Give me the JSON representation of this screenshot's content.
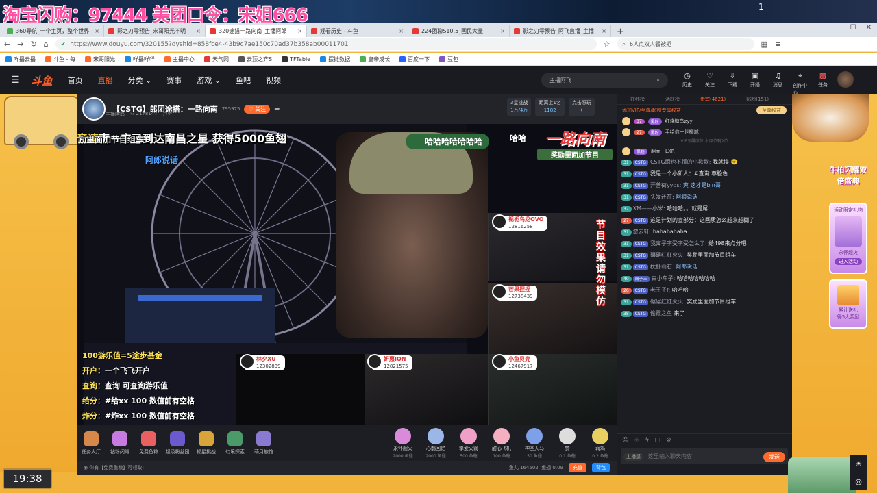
{
  "promo_banner": "淘宝闪购：97444 美团口令：宋姐666",
  "top_badge": "1",
  "tabs": [
    {
      "label": "360导航_一个主页，整个世界",
      "color": "#4caf50"
    },
    {
      "label": "影之刃零预告_宋哥阳光不明",
      "color": "#e53935"
    },
    {
      "label": "320途搭一路向南_主播阿郎",
      "color": "#e53935",
      "active": true
    },
    {
      "label": "观看历史 - 斗鱼",
      "color": "#e53935"
    },
    {
      "label": "224团聊S10.5_国民大量",
      "color": "#e53935"
    },
    {
      "label": "影之刃零预告_阿飞直播_主播",
      "color": "#e53935"
    }
  ],
  "new_tab": "+",
  "url": "https://www.douyu.com/320155?dyshid=858fce4-43b9c7ae150c70ad37b358ab00011701",
  "search_placeholder": "6人点双人餐被拒",
  "bookmarks": [
    "咩播云播",
    "斗鱼 - 每",
    "宋哥阳光",
    "咩播咩咩",
    "主播中心",
    "天气网",
    "云顶之弈S",
    "TFTable",
    "摆摊数据",
    "皇帝成长",
    "百度一下",
    "豆包"
  ],
  "dy": {
    "logo": "斗鱼",
    "nav": [
      "首页",
      "直播",
      "分类",
      "赛事",
      "游戏",
      "鱼吧",
      "视频"
    ],
    "active_nav": "直播",
    "search": "主播阿飞",
    "icons": [
      {
        "label": "历史",
        "icon": "clock-icon"
      },
      {
        "label": "关注",
        "icon": "heart-icon"
      },
      {
        "label": "下载",
        "icon": "download-icon"
      },
      {
        "label": "开播",
        "icon": "broadcast-icon"
      },
      {
        "label": "消息",
        "icon": "bell-icon"
      },
      {
        "label": "创作中心",
        "icon": "location-icon"
      },
      {
        "label": "任务",
        "icon": "gift-icon"
      }
    ]
  },
  "room": {
    "title": "【CSTG】郎团途搭：一路向南",
    "room_no": "795975",
    "follow": "关注",
    "host": "主播阿郎",
    "viewers": "2178147",
    "category": "户外",
    "rank1_title": "3星挑战",
    "rank1_val": "1万/4万",
    "rank2_title": "距离上1名",
    "rank2_val": "1182",
    "rank3_title": "点击照玩"
  },
  "video": {
    "banner_a": "音速",
    "banner": "南一宁已到达南昌之星 获得5000鱼翅",
    "sub_banner": "励里面加节目组车",
    "alang": "阿郎说话",
    "haha": "哈哈哈哈哈哈哈",
    "haha2": "哈哈",
    "road_logo": "一路向南",
    "road_sub": "奖励里面加节目",
    "notice": "节目效果请勿模仿",
    "rules": [
      {
        "k": "100游乐值=5途步基金",
        "v": ""
      },
      {
        "k": "开户：",
        "v": "一个飞飞开户"
      },
      {
        "k": "查询：",
        "v": "查询 可查询游乐值"
      },
      {
        "k": "给分：",
        "v": "#给xx 100 数值前有空格"
      },
      {
        "k": "炸分：",
        "v": "#炸xx 100 数值前有空格"
      }
    ],
    "guests": [
      {
        "name": "栀栀乌龙OVO",
        "id": "12816258"
      },
      {
        "name": "芒果捏捏",
        "id": "12738439"
      },
      {
        "name": "林夕XU",
        "id": "12302839"
      },
      {
        "name": "妍惠ION",
        "id": "12821575"
      },
      {
        "name": "小鱼贝壳",
        "id": "12467917"
      }
    ]
  },
  "gift_tools": [
    "任务大厅",
    "钻粉闪耀",
    "免费鱼粮",
    "超级粉丝团",
    "福星挑战",
    "幻境探索",
    "萌月旅馆"
  ],
  "gifts": [
    {
      "name": "永怀超火",
      "price": "2000 鱼翅",
      "color": "#d98ad9"
    },
    {
      "name": "心鹊回忆",
      "price": "2000 鱼翅",
      "color": "#9ab7e8"
    },
    {
      "name": "擎爱火箭",
      "price": "500 鱼翅",
      "color": "#f0a0c8"
    },
    {
      "name": "甜心飞机",
      "price": "100 鱼翅",
      "color": "#f4b0c0"
    },
    {
      "name": "神圣天马",
      "price": "50 鱼翅",
      "color": "#7ea0e8"
    },
    {
      "name": "赞",
      "price": "0.1 鱼翅",
      "color": "#dddddd"
    },
    {
      "name": "弱鸡",
      "price": "0.2 鱼翅",
      "color": "#e8d060"
    }
  ],
  "bottom": {
    "notice": "你有【免费鱼粮】可领取!",
    "fishball": "鱼丸 164502",
    "fishwing": "鱼翅 0.09",
    "charge": "充值",
    "pack": "背包"
  },
  "chat": {
    "tabs": [
      "在线榜",
      "活跃榜",
      "贵宾(4621)",
      "贴粉(151)"
    ],
    "active_tab": "贵宾(4621)",
    "vip_notice": "添加VIP/至尊/超粉专属权益",
    "vip_btn": "至尊权益",
    "vip_rows": [
      {
        "lv": "37",
        "fan": "黑粉",
        "nick": "红烧糖鸟zyy"
      },
      {
        "lv": "27",
        "fan": "黑粉",
        "nick": "手绘你一世柳城"
      },
      {
        "lv": "",
        "fan": "黑粉",
        "nick": "翻面王LXR"
      }
    ],
    "vip_sep": "VIP专属席位 本席位剩2位",
    "messages": [
      {
        "lv": "31",
        "fan": "CSTG",
        "nick": "CSTG瞬也不懂的小欺欺:",
        "text": "我就摸 🙂",
        "hl": false
      },
      {
        "lv": "31",
        "fan": "CSTG",
        "nick": "",
        "text": "我是一个小新人：#查询 尊脸色",
        "hl": false
      },
      {
        "lv": "31",
        "fan": "CSTG",
        "nick": "开普荷yyds:",
        "text": "爽 这才是bin哥",
        "hl": true
      },
      {
        "lv": "31",
        "fan": "CSTG",
        "nick": "头发还在:",
        "text": "阿狼说话",
        "hl": true
      },
      {
        "lv": "37",
        "fan": "",
        "nick": "XM——小米:",
        "text": "哈哈哈。。就是屌",
        "hl": false
      },
      {
        "lv": "27",
        "fan": "CSTG",
        "nick": "",
        "text": "这是计划的宣部分：这画质怎么越来越糊了",
        "hl": false,
        "red": true
      },
      {
        "lv": "31",
        "fan": "",
        "nick": "忽云轩:",
        "text": "hahahahaha",
        "hl": false
      },
      {
        "lv": "31",
        "fan": "CSTG",
        "nick": "我寓子字受字受怎么了:",
        "text": "给498来点分吧",
        "hl": false
      },
      {
        "lv": "31",
        "fan": "CSTG",
        "nick": "碾碾红红火火:",
        "text": "奖励里面加节目组车",
        "hl": false
      },
      {
        "lv": "31",
        "fan": "CSTG",
        "nick": "枕卧山石:",
        "text": "阿郎说话",
        "hl": true
      },
      {
        "lv": "40",
        "fan": "南子王",
        "nick": "白小车子:",
        "text": "哈哈哈哈哈哈哈",
        "hl": false
      },
      {
        "lv": "26",
        "fan": "CSTG",
        "nick": "老王子f:",
        "text": "哈哈哈",
        "hl": false,
        "red": true
      },
      {
        "lv": "31",
        "fan": "CSTG",
        "nick": "碾碾红红火火:",
        "text": "奖励里面加节目组车",
        "hl": false
      },
      {
        "lv": "38",
        "fan": "CSTG",
        "nick": "偷霞之鱼",
        "text": "来了",
        "hl": false
      }
    ],
    "input_placeholder": "这里输入聊天内容",
    "send": "发送",
    "host_badge": "主播感"
  },
  "side_promo": "牛柏闪耀双倍盛典",
  "cards": [
    {
      "title": "活动限定礼物",
      "sub": "永怀超火",
      "btn": "进入活动"
    },
    {
      "title": "累计送礼",
      "sub": "得5大奖励"
    }
  ],
  "clock": "19:38"
}
